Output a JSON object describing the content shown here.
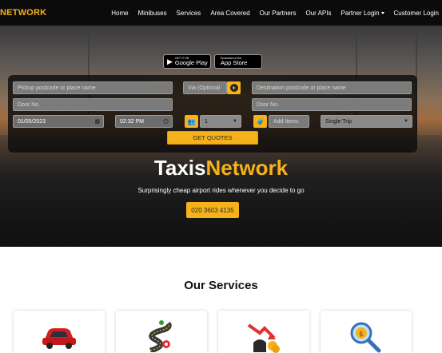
{
  "nav": {
    "brand": "NETWORK",
    "links": [
      "Home",
      "Minibuses",
      "Services",
      "Area Covered",
      "Our Partners",
      "Our APIs",
      "Partner Login",
      "Customer Login"
    ]
  },
  "stores": {
    "google": {
      "small": "GET IT ON",
      "big": "Google Play"
    },
    "apple": {
      "small": "Download on the",
      "big": "App Store"
    }
  },
  "form": {
    "pickup_placeholder": "Pickup postcode or place name",
    "via_placeholder": "Via (Optional",
    "destination_placeholder": "Destination postcode or place name",
    "door_no_1": "Door No.",
    "door_no_2": "Door No.",
    "date": "01/05/2023",
    "time": "02:32 PM",
    "passengers": "1",
    "add_items": "Add Items",
    "trip_type": "Single Trip",
    "get_quotes": "GET QUOTES"
  },
  "hero": {
    "logo_part1": "Taxis",
    "logo_part2": "Network",
    "tagline": "Surprisingly cheap airport rides whenever you decide to go",
    "phone": "020 3603 4135"
  },
  "services": {
    "title": "Our Services",
    "cards": [
      "car-icon",
      "route-icon",
      "price-drop-icon",
      "price-search-icon"
    ]
  },
  "colors": {
    "accent": "#f5b21b",
    "nav_bg": "#0b0b0b"
  }
}
